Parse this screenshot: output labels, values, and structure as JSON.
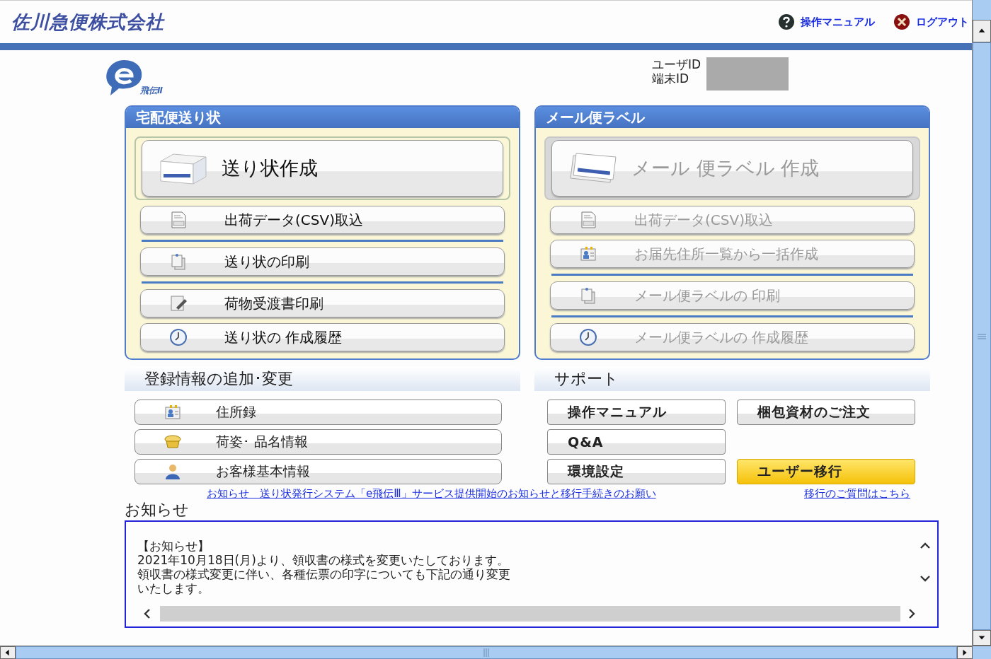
{
  "header": {
    "company": "佐川急便株式会社",
    "links": [
      {
        "kind": "help",
        "label": "操作マニュアル"
      },
      {
        "kind": "logout",
        "label": "ログアウト"
      }
    ]
  },
  "logo": {
    "caption": "飛伝Ⅱ"
  },
  "account": {
    "labels": [
      "ユーザID",
      "端末ID"
    ]
  },
  "panels": [
    {
      "title": "宅配便送り状",
      "items": [
        {
          "kind": "box",
          "label": "送り状作成",
          "disabled": false,
          "rule_above": false
        },
        {
          "kind": "csv",
          "label": "出荷データ(CSV)取込",
          "disabled": false,
          "rule_above": false
        },
        {
          "kind": "print",
          "label": "送り状の印刷",
          "disabled": false,
          "rule_above": true
        },
        {
          "kind": "pen",
          "label": "荷物受渡書印刷",
          "disabled": false,
          "rule_above": true
        },
        {
          "kind": "clock",
          "label": "送り状の 作成履歴",
          "disabled": false,
          "rule_above": false
        }
      ]
    },
    {
      "title": "メール便ラベル",
      "items": [
        {
          "kind": "cards",
          "label": "メール 便ラベル 作成",
          "disabled": true,
          "rule_above": false
        },
        {
          "kind": "csv",
          "label": "出荷データ(CSV)取込",
          "disabled": true,
          "rule_above": false
        },
        {
          "kind": "address",
          "label": "お届先住所一覧から一括作成",
          "disabled": true,
          "rule_above": false
        },
        {
          "kind": "print",
          "label": "メール便ラベルの 印刷",
          "disabled": true,
          "rule_above": true
        },
        {
          "kind": "clock",
          "label": "メール便ラベルの 作成履歴",
          "disabled": true,
          "rule_above": true
        }
      ]
    }
  ],
  "registration": {
    "title": "登録情報の追加･変更",
    "items": [
      {
        "kind": "address",
        "label": "住所録"
      },
      {
        "kind": "package",
        "label": "荷姿･ 品名情報"
      },
      {
        "kind": "person",
        "label": "お客様基本情報"
      }
    ]
  },
  "support": {
    "title": "サポート",
    "columns": [
      [
        {
          "label": "操作マニュアル",
          "highlighted": false
        },
        {
          "label": "Q&A",
          "highlighted": false
        },
        {
          "label": "環境設定",
          "highlighted": false
        }
      ],
      [
        {
          "label": "梱包資材のご注文",
          "highlighted": false
        },
        {
          "label": "ユーザー移行",
          "highlighted": true
        }
      ]
    ]
  },
  "links": [
    "お知らせ　送り状発行システム「e飛伝Ⅲ」サービス提供開始のお知らせと移行手続きのお願い",
    "移行のご質問はこちら"
  ],
  "notice": {
    "title": "お知らせ",
    "lines": [
      "【お知らせ】",
      "2021年10月18日(月)より、領収書の様式を変更いたしております。",
      "領収書の様式変更に伴い、各種伝票の印字についても下記の通り変更",
      "いたします。"
    ]
  }
}
